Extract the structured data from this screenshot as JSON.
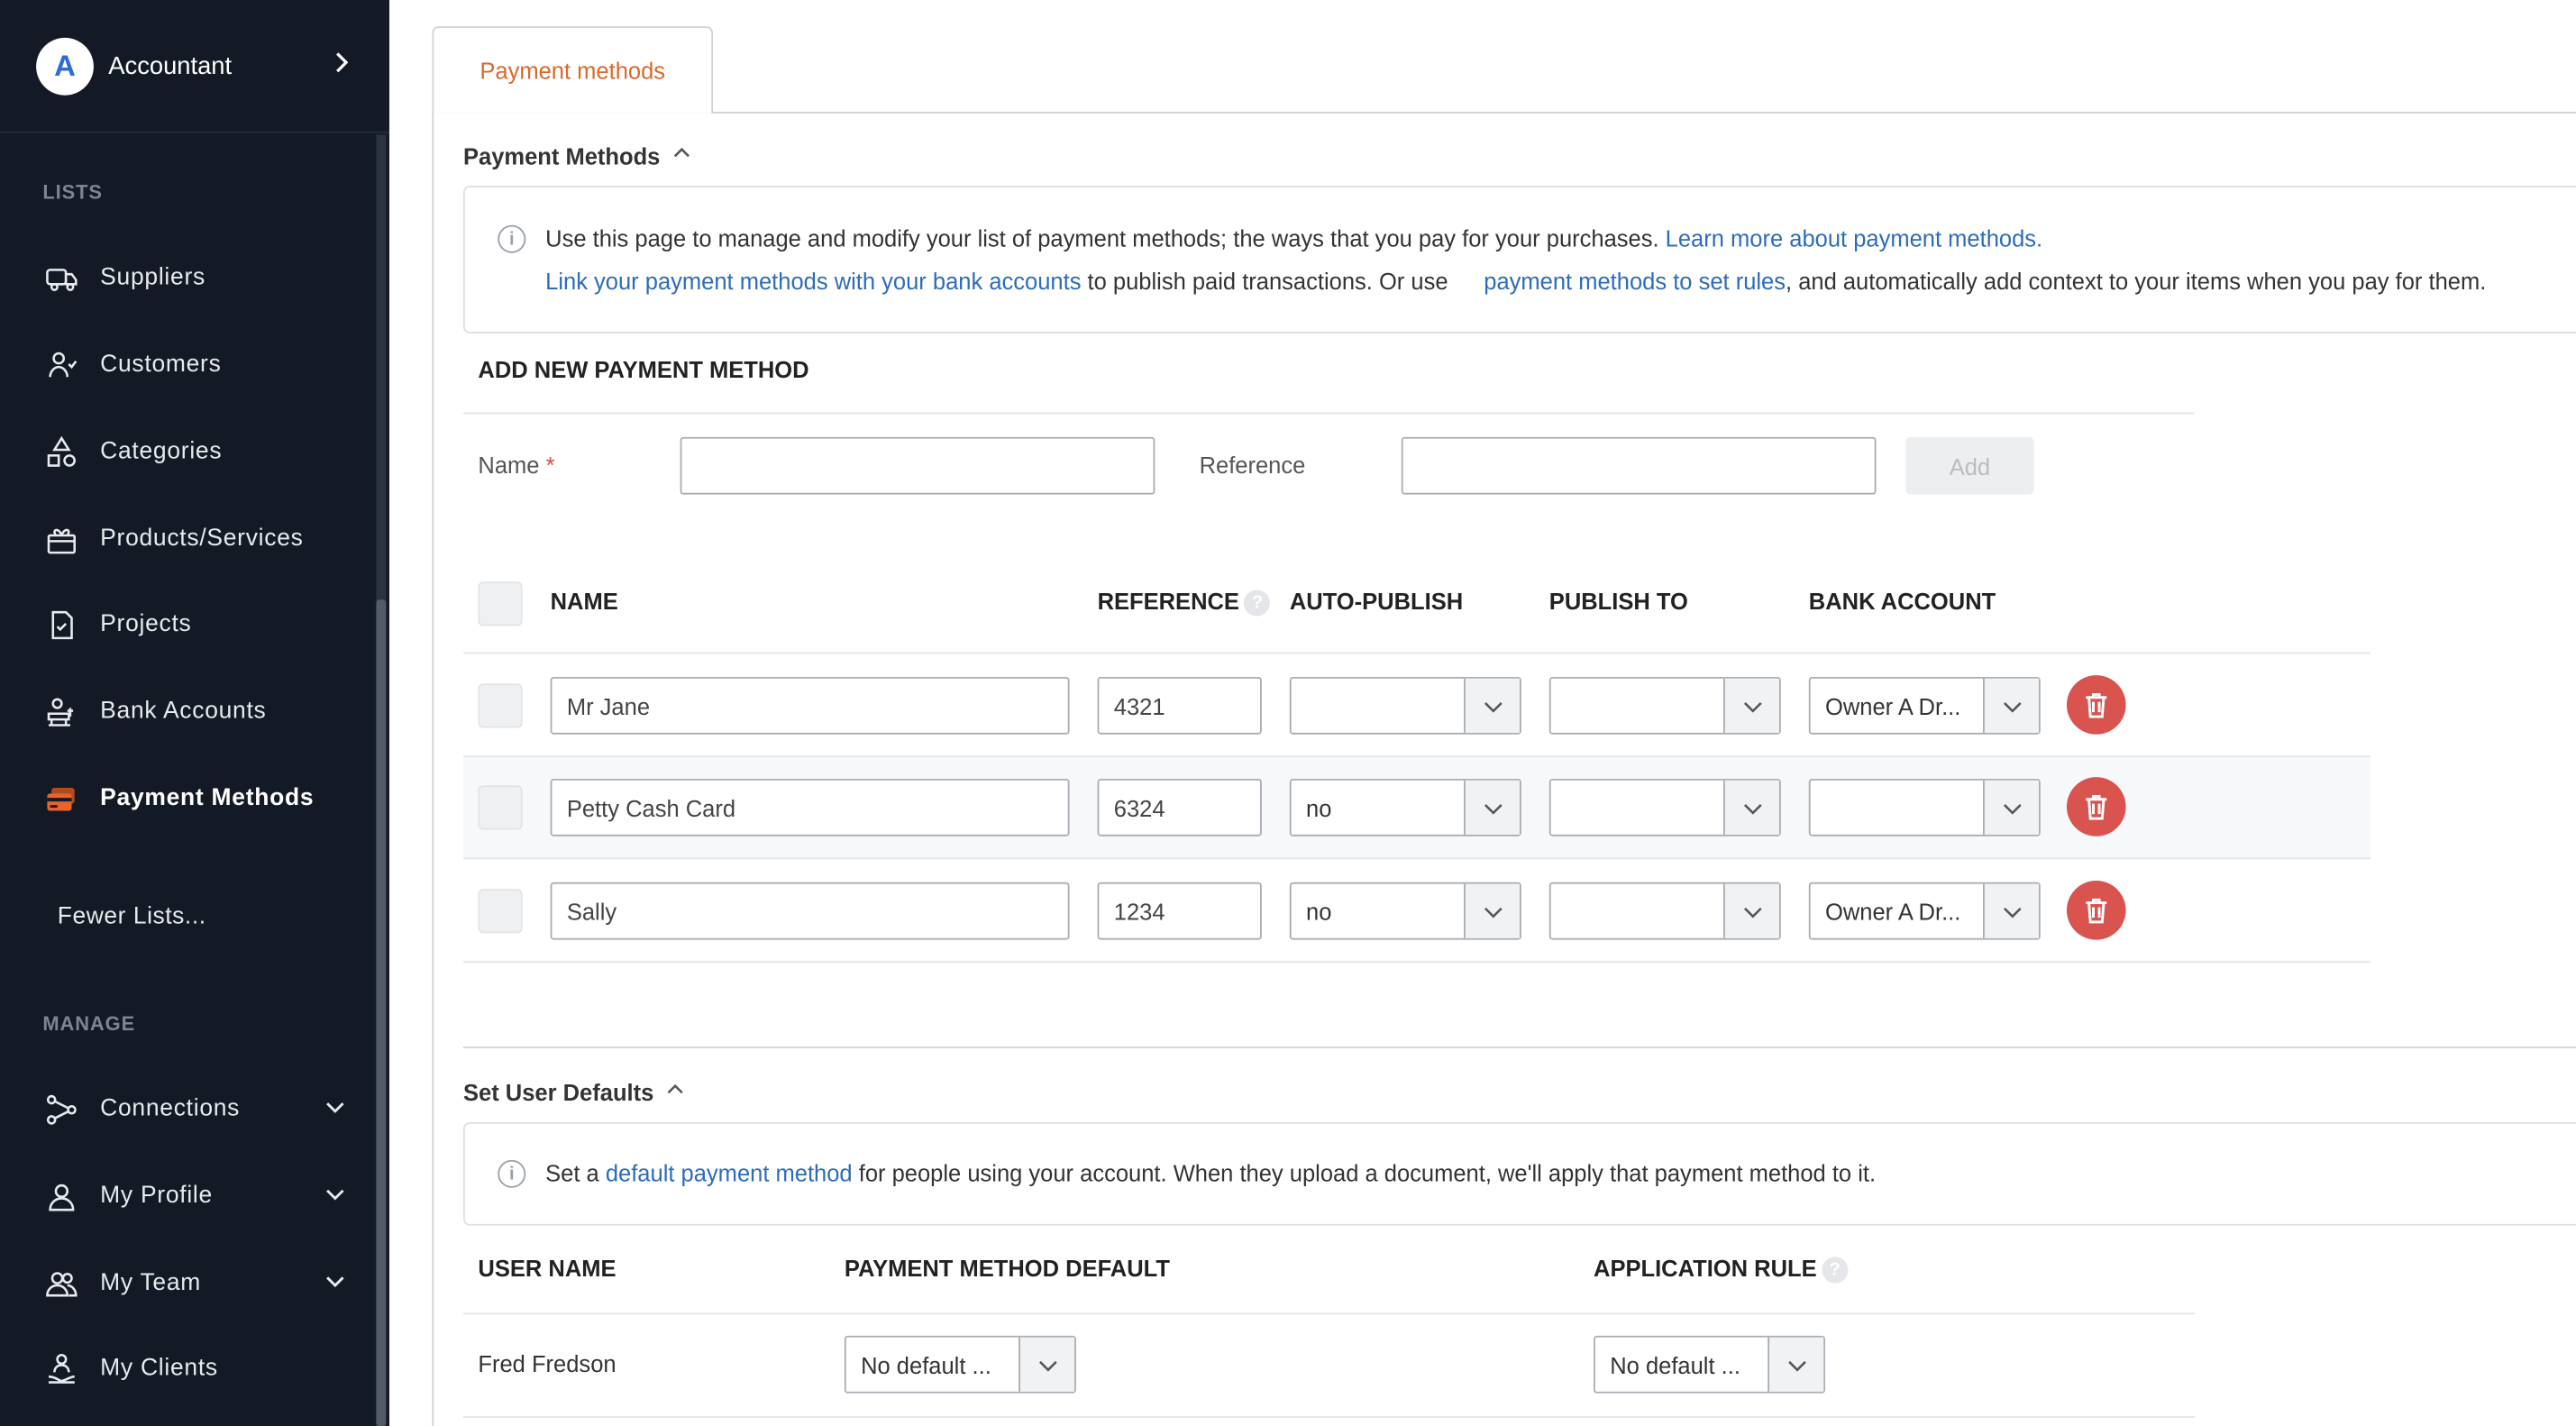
{
  "sidebar": {
    "account": {
      "initial": "A",
      "name": "Accountant"
    },
    "sections": {
      "lists": "LISTS",
      "manage": "MANAGE"
    },
    "lists": [
      {
        "label": "Suppliers",
        "icon": "truck-icon"
      },
      {
        "label": "Customers",
        "icon": "customers-icon"
      },
      {
        "label": "Categories",
        "icon": "categories-icon"
      },
      {
        "label": "Products/Services",
        "icon": "products-icon"
      },
      {
        "label": "Projects",
        "icon": "projects-icon"
      },
      {
        "label": "Bank Accounts",
        "icon": "bank-icon"
      },
      {
        "label": "Payment Methods",
        "icon": "credit-card-icon",
        "active": true
      }
    ],
    "fewer": "Fewer Lists...",
    "manage": [
      {
        "label": "Connections",
        "icon": "connections-icon"
      },
      {
        "label": "My Profile",
        "icon": "profile-icon"
      },
      {
        "label": "My Team",
        "icon": "team-icon"
      },
      {
        "label": "My Clients",
        "icon": "clients-icon"
      }
    ],
    "accent_color": "#e8632b"
  },
  "tab": {
    "label": "Payment methods"
  },
  "payment_methods": {
    "title": "Payment Methods",
    "info": {
      "line1": "Use this page to manage and modify your list of payment methods; the ways that you pay for your purchases.",
      "link1": "Learn more about payment methods.",
      "link2": "Link your payment methods with your bank accounts",
      "mid": "to publish paid transactions. Or use",
      "link3": "payment methods to set rules",
      "end": ", and automatically add context to your items when you pay for them."
    },
    "add_new": {
      "title": "ADD NEW PAYMENT METHOD",
      "name_label": "Name",
      "required_mark": "*",
      "reference_label": "Reference",
      "name_value": "",
      "reference_value": "",
      "add_label": "Add"
    },
    "columns": {
      "name": "NAME",
      "reference": "REFERENCE",
      "auto_publish": "AUTO-PUBLISH",
      "publish_to": "PUBLISH TO",
      "bank_account": "BANK ACCOUNT",
      "help": "?"
    },
    "rows": [
      {
        "name": "Mr Jane",
        "reference": "4321",
        "auto_publish": "",
        "publish_to": "",
        "bank_account": "Owner A Dr..."
      },
      {
        "name": "Petty Cash Card",
        "reference": "6324",
        "auto_publish": "no",
        "publish_to": "",
        "bank_account": ""
      },
      {
        "name": "Sally",
        "reference": "1234",
        "auto_publish": "no",
        "publish_to": "",
        "bank_account": "Owner A Dr..."
      }
    ],
    "delete_color": "#d9534f"
  },
  "user_defaults": {
    "title": "Set User Defaults",
    "info": {
      "pre": "Set a",
      "link": "default payment method",
      "post": "for people using your account. When they upload a document, we'll apply that payment method to it."
    },
    "columns": {
      "user_name": "USER NAME",
      "payment_method_default": "PAYMENT METHOD DEFAULT",
      "application_rule": "APPLICATION RULE",
      "help": "?"
    },
    "rows": [
      {
        "user_name": "Fred Fredson",
        "payment_method_default": "No default ...",
        "application_rule": "No default ..."
      }
    ]
  }
}
